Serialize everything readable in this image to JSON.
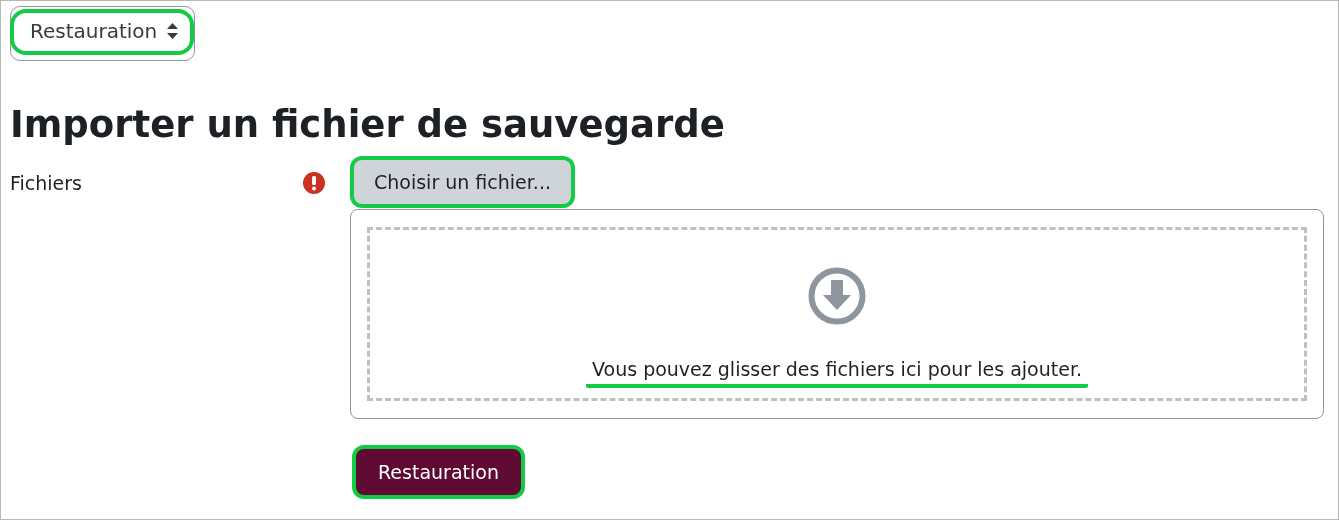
{
  "select": {
    "value": "Restauration",
    "highlighted": true
  },
  "heading": "Importer un fichier de sauvegarde",
  "field": {
    "label": "Fichiers",
    "required": true,
    "button": {
      "label": "Choisir un fichier...",
      "highlighted": true
    },
    "dropzone": {
      "text": "Vous pouvez glisser des fichiers ici pour les ajouter.",
      "underlined": true
    }
  },
  "submit": {
    "label": "Restauration",
    "highlighted": true
  }
}
